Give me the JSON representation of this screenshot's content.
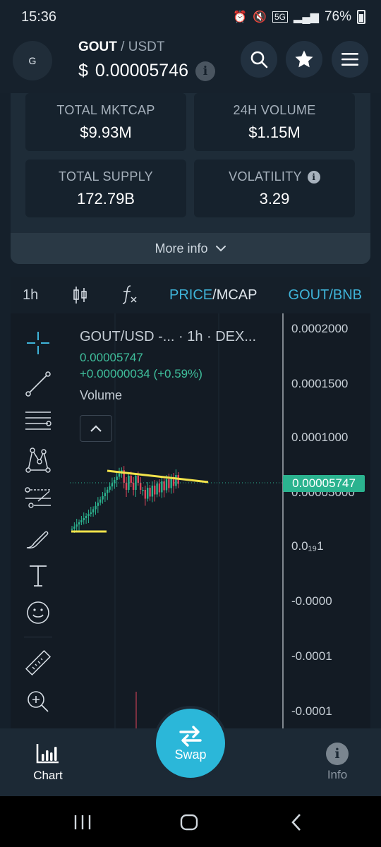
{
  "status_bar": {
    "time": "15:36",
    "network": "5G",
    "battery": "76%"
  },
  "header": {
    "token_initial": "G",
    "base": "GOUT",
    "separator": "/",
    "quote": "USDT",
    "currency_symbol": "$",
    "price": "0.00005746"
  },
  "stats": {
    "market_cap": {
      "label": "TOTAL MKTCAP",
      "value": "$9.93M"
    },
    "volume_24h": {
      "label": "24H VOLUME",
      "value": "$1.15M"
    },
    "total_supply": {
      "label": "TOTAL SUPPLY",
      "value": "172.79B"
    },
    "volatility": {
      "label": "VOLATILITY",
      "value": "3.29"
    },
    "more_info_label": "More info"
  },
  "chart_toolbar": {
    "timeframe": "1h",
    "price_label": "PRICE",
    "slash": "/",
    "mcap_label": "MCAP",
    "pair_switch": "GOUT/BNB"
  },
  "chart_legend": {
    "title": "GOUT/USD -...  · 1h · DEX...",
    "last_price": "0.00005747",
    "change": "+0.00000034 (+0.59%)",
    "volume_label": "Volume"
  },
  "chart_data": {
    "type": "candlestick",
    "y_axis_ticks": [
      "0.0002000",
      "0.0001500",
      "0.0001000",
      "0.00005000",
      "0.0₁₉1",
      "-0.0000",
      "-0.0001",
      "-0.0001"
    ],
    "current_price_tag": "0.00005747",
    "ylim": [
      -0.00014,
      0.0002
    ]
  },
  "bottom_nav": {
    "chart_label": "Chart",
    "swap_label": "Swap",
    "info_label": "Info"
  },
  "colors": {
    "accent": "#2bb7d9",
    "up": "#2bb38f",
    "down": "#e0455b",
    "trendline": "#f2e34b"
  }
}
